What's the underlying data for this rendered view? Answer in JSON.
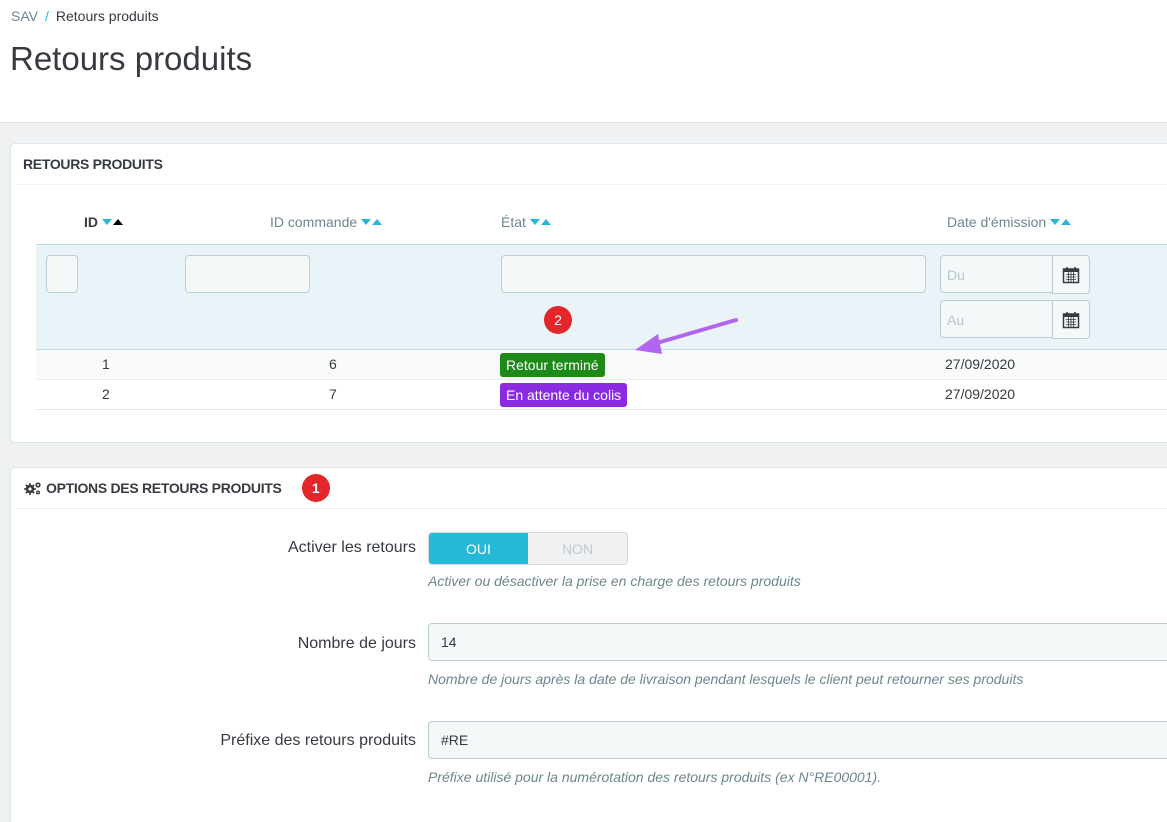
{
  "breadcrumb": {
    "parent": "SAV",
    "separator": "/",
    "current": "Retours produits"
  },
  "page_title": "Retours produits",
  "returns_panel": {
    "heading": "RETOURS PRODUITS",
    "columns": {
      "id": "ID",
      "order_id": "ID commande",
      "state": "État",
      "date": "Date d'émission"
    },
    "filters": {
      "date_from_placeholder": "Du",
      "date_to_placeholder": "Au"
    },
    "rows": [
      {
        "id": "1",
        "order_id": "6",
        "state": "Retour terminé",
        "state_color": "#1e8a1a",
        "date": "27/09/2020"
      },
      {
        "id": "2",
        "order_id": "7",
        "state": "En attente du colis",
        "state_color": "#8a2be2",
        "date": "27/09/2020"
      }
    ]
  },
  "options_panel": {
    "heading": "OPTIONS DES RETOURS PRODUITS",
    "enable_returns": {
      "label": "Activer les retours",
      "on": "OUI",
      "off": "NON",
      "help": "Activer ou désactiver la prise en charge des retours produits"
    },
    "days": {
      "label": "Nombre de jours",
      "value": "14",
      "help": "Nombre de jours après la date de livraison pendant lesquels le client peut retourner ses produits"
    },
    "prefix": {
      "label": "Préfixe des retours produits",
      "value": "#RE",
      "help": "Préfixe utilisé pour la numérotation des retours produits (ex N°RE00001)."
    }
  },
  "annotations": {
    "marker_1": "1",
    "marker_2": "2",
    "arrow_color": "#b266f0"
  }
}
